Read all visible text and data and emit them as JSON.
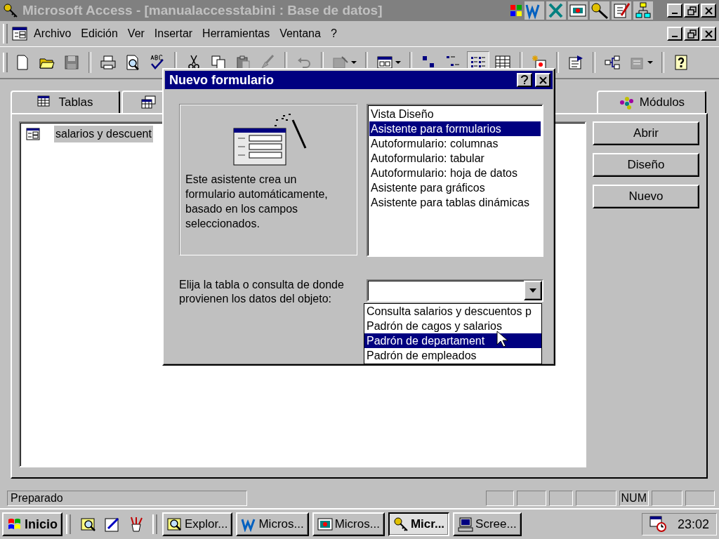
{
  "window": {
    "title": "Microsoft Access - [manualaccesstabini : Base de datos]",
    "active": false
  },
  "menu": [
    "Archivo",
    "Edición",
    "Ver",
    "Insertar",
    "Herramientas",
    "Ventana",
    "?"
  ],
  "view_buttons": [
    {
      "kind": "large",
      "selected": false
    },
    {
      "kind": "small",
      "selected": false
    },
    {
      "kind": "list",
      "selected": true
    },
    {
      "kind": "details",
      "selected": false
    }
  ],
  "database_window": {
    "tabs": [
      {
        "kind": "tables",
        "label": "Tablas",
        "selected": false
      },
      {
        "kind": "queries",
        "selected": false
      },
      {
        "kind": "modules",
        "label": "Módulos",
        "selected": false
      }
    ],
    "items": [
      {
        "label": "salarios y descuent",
        "selected": true
      }
    ],
    "buttons": [
      "Abrir",
      "Diseño",
      "Nuevo"
    ]
  },
  "dialog": {
    "title": "Nuevo formulario",
    "description": "Este asistente crea un formulario automáticamente, basado en los campos seleccionados.",
    "options": [
      {
        "label": "Vista Diseño",
        "selected": false
      },
      {
        "label": "Asistente para formularios",
        "selected": true
      },
      {
        "label": "Autoformulario: columnas",
        "selected": false
      },
      {
        "label": "Autoformulario: tabular",
        "selected": false
      },
      {
        "label": "Autoformulario: hoja de datos",
        "selected": false
      },
      {
        "label": "Asistente para gráficos",
        "selected": false
      },
      {
        "label": "Asistente para tablas dinámicas",
        "selected": false
      }
    ],
    "source_label": "Elija la tabla o consulta de donde provienen los datos del objeto:",
    "dropdown_items": [
      {
        "label": "Consulta salarios y descuentos p",
        "selected": false
      },
      {
        "label": "Padrón de cagos y salarios",
        "selected": false
      },
      {
        "label": "Padrón de departament",
        "selected": true
      },
      {
        "label": "Padrón de empleados",
        "selected": false
      }
    ]
  },
  "status_bar": {
    "text": "Preparado",
    "indicator": "NUM"
  },
  "taskbar": {
    "start": "Inicio",
    "tasks": [
      {
        "kind": "explorer",
        "label": "Explor...",
        "selected": false
      },
      {
        "kind": "word",
        "label": "Micros...",
        "selected": false
      },
      {
        "kind": "presentation",
        "label": "Micros...",
        "selected": false
      },
      {
        "kind": "access",
        "label": "Micr...",
        "selected": true
      },
      {
        "kind": "screen",
        "label": "Scree...",
        "selected": false
      }
    ],
    "clock": "23:02"
  }
}
